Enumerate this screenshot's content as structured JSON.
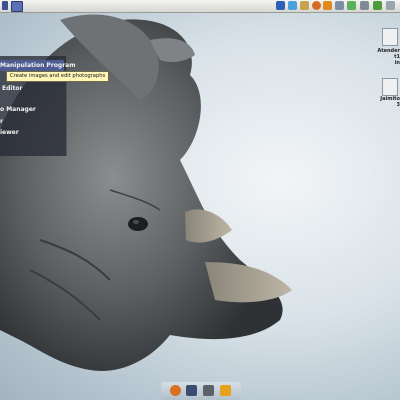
{
  "menu": {
    "items": [
      {
        "label": "Manipulation Program"
      },
      {
        "label": "s"
      },
      {
        "label": "Editor"
      },
      {
        "label": "o Manager"
      },
      {
        "label": "r"
      },
      {
        "label": "iewer"
      }
    ]
  },
  "tooltip": {
    "text": "Create images and edit photographs"
  },
  "desktop_icons": [
    {
      "label1": "Atender",
      "label2": "t1",
      "label3": "in"
    },
    {
      "label1": "Jaimito",
      "label2": "3"
    }
  ],
  "icons": {
    "top_left": [
      "app-icon",
      "window-icon"
    ],
    "tray": [
      "network-icon",
      "update-icon",
      "folder-icon",
      "firefox-icon",
      "star-icon",
      "settings-icon",
      "chat-icon",
      "volume-icon",
      "battery-icon"
    ],
    "dock": [
      "firefox-icon",
      "kde-icon",
      "speaker-icon",
      "wifi-icon"
    ]
  }
}
